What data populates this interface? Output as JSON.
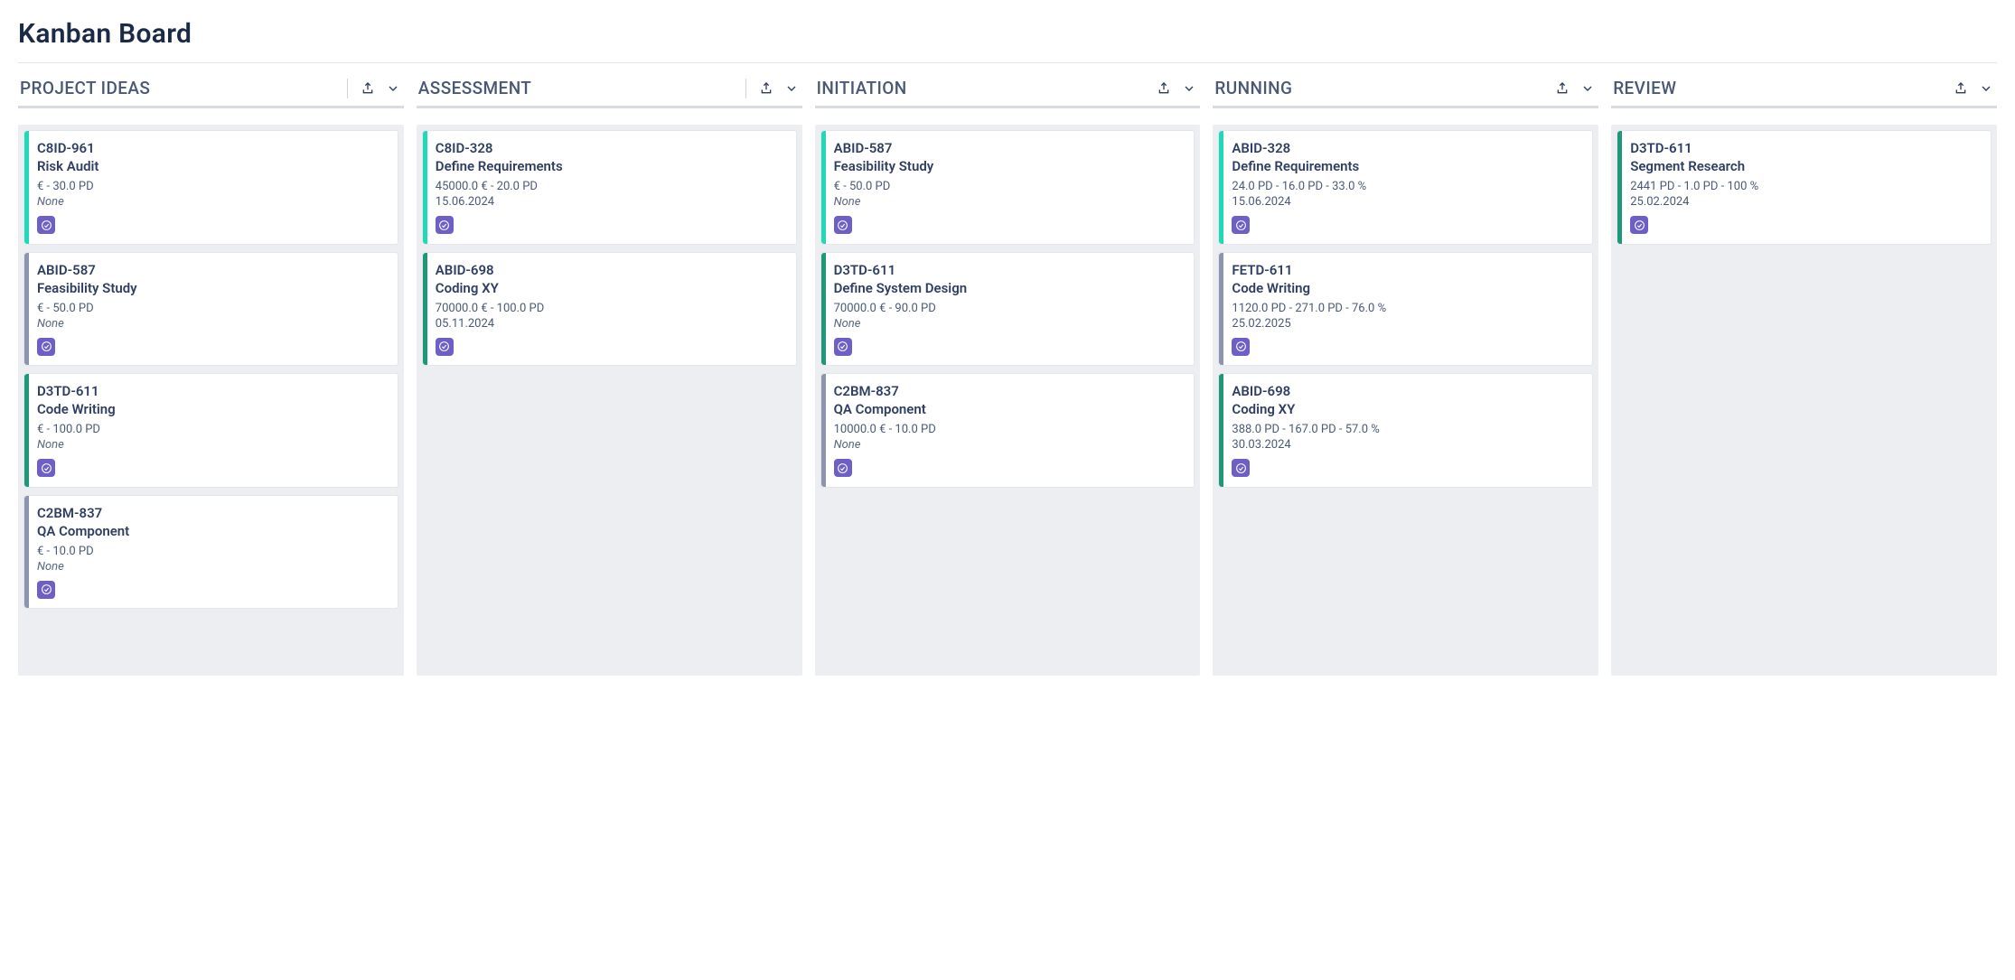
{
  "title": "Kanban Board",
  "stripe_colors": {
    "teal": "#1fd9b8",
    "slate": "#8c95ab",
    "green": "#1f987a"
  },
  "columns": [
    {
      "name": "PROJECT IDEAS",
      "show_divider": true,
      "cards": [
        {
          "id": "C8ID-961",
          "title": "Risk Audit",
          "line1": "€ - 30.0 PD",
          "line2": "None",
          "line2_is_none": true,
          "stripe": "teal"
        },
        {
          "id": "ABID-587",
          "title": "Feasibility Study",
          "line1": "€ - 50.0 PD",
          "line2": "None",
          "line2_is_none": true,
          "stripe": "slate"
        },
        {
          "id": "D3TD-611",
          "title": "Code Writing",
          "line1": "€ - 100.0 PD",
          "line2": "None",
          "line2_is_none": true,
          "stripe": "green"
        },
        {
          "id": "C2BM-837",
          "title": "QA Component",
          "line1": "€ - 10.0 PD",
          "line2": "None",
          "line2_is_none": true,
          "stripe": "slate"
        }
      ]
    },
    {
      "name": "ASSESSMENT",
      "show_divider": true,
      "cards": [
        {
          "id": "C8ID-328",
          "title": "Define Requirements",
          "line1": "45000.0 € - 20.0 PD",
          "line2": "15.06.2024",
          "line2_is_none": false,
          "stripe": "teal"
        },
        {
          "id": "ABID-698",
          "title": "Coding XY",
          "line1": "70000.0 € - 100.0 PD",
          "line2": "05.11.2024",
          "line2_is_none": false,
          "stripe": "green"
        }
      ]
    },
    {
      "name": "INITIATION",
      "show_divider": false,
      "cards": [
        {
          "id": "ABID-587",
          "title": "Feasibility Study",
          "line1": "€ - 50.0 PD",
          "line2": "None",
          "line2_is_none": true,
          "stripe": "teal"
        },
        {
          "id": "D3TD-611",
          "title": "Define System Design",
          "line1": "70000.0 € - 90.0 PD",
          "line2": "None",
          "line2_is_none": true,
          "stripe": "green"
        },
        {
          "id": "C2BM-837",
          "title": "QA Component",
          "line1": "10000.0 € - 10.0 PD",
          "line2": "None",
          "line2_is_none": true,
          "stripe": "slate"
        }
      ]
    },
    {
      "name": "RUNNING",
      "show_divider": false,
      "cards": [
        {
          "id": "ABID-328",
          "title": "Define Requirements",
          "line1": "24.0 PD - 16.0 PD - 33.0 %",
          "line2": "15.06.2024",
          "line2_is_none": false,
          "stripe": "teal"
        },
        {
          "id": "FETD-611",
          "title": "Code Writing",
          "line1": "1120.0 PD - 271.0 PD - 76.0 %",
          "line2": "25.02.2025",
          "line2_is_none": false,
          "stripe": "slate"
        },
        {
          "id": "ABID-698",
          "title": "Coding XY",
          "line1": "388.0 PD - 167.0 PD - 57.0 %",
          "line2": "30.03.2024",
          "line2_is_none": false,
          "stripe": "green"
        }
      ]
    },
    {
      "name": "REVIEW",
      "show_divider": false,
      "cards": [
        {
          "id": "D3TD-611",
          "title": "Segment Research",
          "line1": "2441 PD - 1.0 PD - 100 %",
          "line2": "25.02.2024",
          "line2_is_none": false,
          "stripe": "green"
        }
      ]
    }
  ]
}
